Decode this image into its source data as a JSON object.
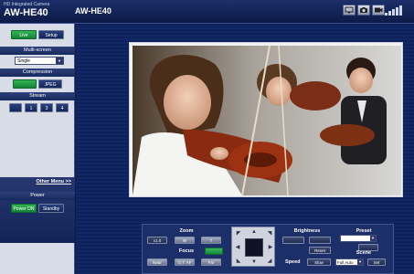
{
  "header": {
    "brand_sub": "HD Integrated Camera",
    "model": "AW-HE40",
    "camera_title": "AW-HE40",
    "icons": [
      "display-icon",
      "camera-icon",
      "record-icon",
      "signal-strength-icon"
    ]
  },
  "sidebar": {
    "live_label": "Live",
    "setup_label": "Setup",
    "multiscreen_title": "Multi-screen",
    "multiscreen_value": "Single",
    "compression_title": "Compression",
    "compression_h264": "",
    "compression_jpeg": "JPEG",
    "stream_title": "Stream",
    "stream_buttons": [
      "",
      "1",
      "3",
      "4"
    ],
    "other_menu": "Other Menu >>",
    "power_title": "Power",
    "power_on": "Power ON",
    "standby": "Standby"
  },
  "controls": {
    "zoom_title": "Zoom",
    "zoom_x1": "x1.0",
    "zoom_out": "W",
    "zoom_in": "T",
    "focus_title": "Focus",
    "focus_near": "Near",
    "focus_auto": "O.T. AF",
    "focus_far": "Far",
    "focus_toggle": "",
    "brightness_title": "Brightness",
    "brightness_minus": "",
    "brightness_plus": "",
    "brightness_reset": "Reset",
    "speed_title": "Speed",
    "speed_value": "Slow",
    "preset_title": "Preset",
    "preset_value": "",
    "scene_title": "Scene",
    "scene_value": "Full Auto",
    "scene_set": "Set"
  },
  "colors": {
    "header_bg": "#0c1a47",
    "panel_bg": "#d7dce6",
    "active_green": "#14823a",
    "navy": "#172a5e"
  }
}
